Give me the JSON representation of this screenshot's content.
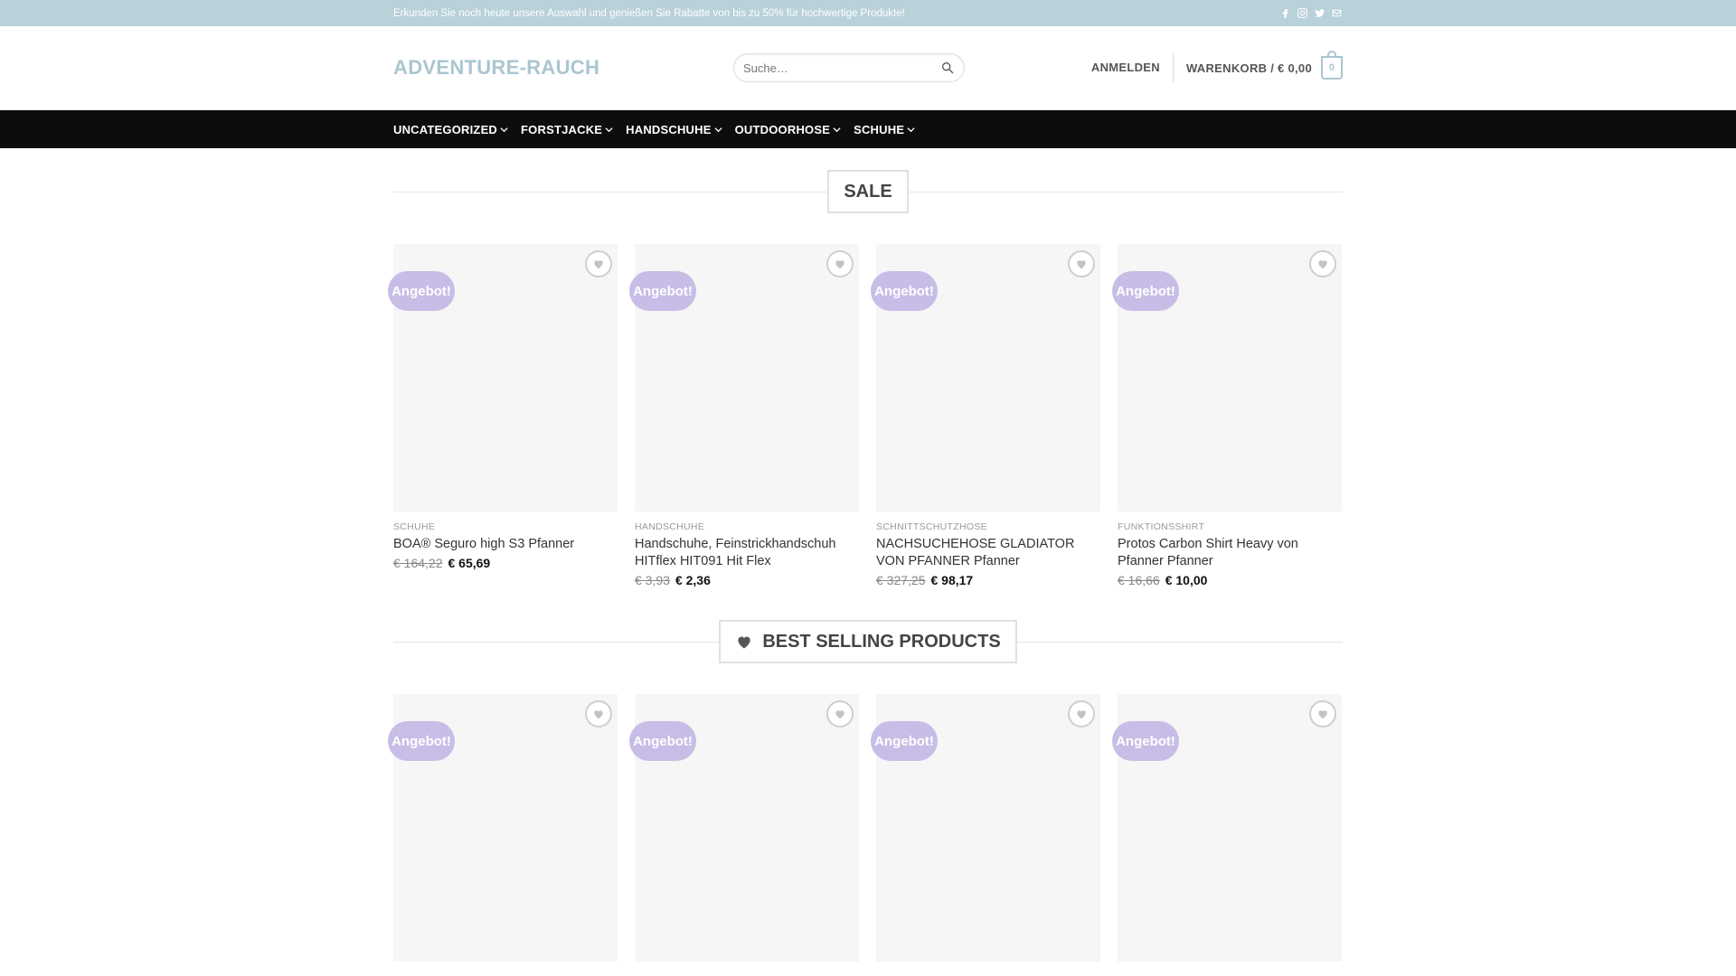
{
  "topbar": {
    "message": "Erkunden Sie noch heute unsere Auswahl und genießen Sie Rabatte von bis zu 50% für hochwertige Produkte!",
    "social": [
      "facebook-icon",
      "instagram-icon",
      "twitter-icon",
      "email-icon"
    ]
  },
  "header": {
    "logo": "ADVENTURE-RAUCH",
    "search_placeholder": "Suche…",
    "login": "ANMELDEN",
    "cart_label": "WARENKORB / € 0,00",
    "cart_count": "0"
  },
  "nav": {
    "items": [
      {
        "label": "UNCATEGORIZED"
      },
      {
        "label": "FORSTJACKE"
      },
      {
        "label": "HANDSCHUHE"
      },
      {
        "label": "OUTDOORHOSE"
      },
      {
        "label": "SCHUHE"
      }
    ]
  },
  "sections": {
    "sale_title": "SALE",
    "bestselling_title": "BEST SELLING PRODUCTS"
  },
  "sale_badge": "Angebot!",
  "sale_products": [
    {
      "category": "SCHUHE",
      "name": "BOA® Seguro high S3 Pfanner",
      "old_price": "€ 164,22",
      "new_price": "€ 65,69"
    },
    {
      "category": "HANDSCHUHE",
      "name": "Handschuhe, Feinstrickhandschuh HITflex HIT091 Hit Flex",
      "old_price": "€ 3,93",
      "new_price": "€ 2,36"
    },
    {
      "category": "SCHNITTSCHUTZHOSE",
      "name": "NACHSUCHEHOSE GLADIATOR VON PFANNER Pfanner",
      "old_price": "€ 327,25",
      "new_price": "€ 98,17"
    },
    {
      "category": "FUNKTIONSSHIRT",
      "name": "Protos Carbon Shirt Heavy von Pfanner Pfanner",
      "old_price": "€ 16,66",
      "new_price": "€ 10,00"
    }
  ],
  "colors": {
    "topbar": "#b9d1d9",
    "logo": "#a9c6d1",
    "nav": "#0d0d0d",
    "badge": "#c8bde6"
  }
}
